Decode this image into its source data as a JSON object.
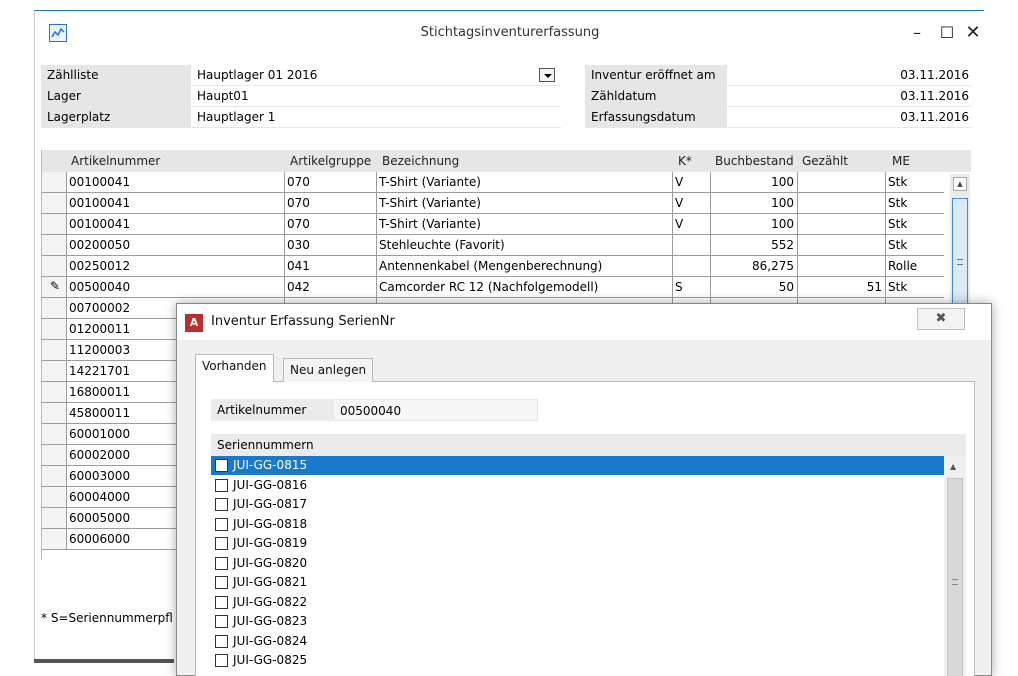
{
  "window": {
    "title": "Stichtagsinventurerfassung",
    "minimize": "–",
    "maximize": "☐",
    "close": "✕"
  },
  "header": {
    "left": [
      {
        "label": "Zählliste",
        "value": "Hauptlager 01 2016"
      },
      {
        "label": "Lager",
        "value": "Haupt01"
      },
      {
        "label": "Lagerplatz",
        "value": "Hauptlager 1"
      }
    ],
    "right": [
      {
        "label": "Inventur eröffnet am",
        "value": "03.11.2016"
      },
      {
        "label": "Zähldatum",
        "value": "03.11.2016"
      },
      {
        "label": "Erfassungsdatum",
        "value": "03.11.2016"
      }
    ]
  },
  "grid": {
    "columns": [
      "Artikelnummer",
      "Artikelgruppe",
      "Bezeichnung",
      "K*",
      "Buchbestand",
      "Gezählt",
      "ME"
    ],
    "rows": [
      [
        "00100041",
        "070",
        "T-Shirt (Variante)",
        "V",
        "100",
        "",
        "Stk"
      ],
      [
        "00100041",
        "070",
        "T-Shirt (Variante)",
        "V",
        "100",
        "",
        "Stk"
      ],
      [
        "00100041",
        "070",
        "T-Shirt (Variante)",
        "V",
        "100",
        "",
        "Stk"
      ],
      [
        "00200050",
        "030",
        "Stehleuchte  (Favorit)",
        "",
        "552",
        "",
        "Stk"
      ],
      [
        "00250012",
        "041",
        "Antennenkabel (Mengenberechnung)",
        "",
        "86,275",
        "",
        "Rolle"
      ],
      [
        "00500040",
        "042",
        "Camcorder RC 12 (Nachfolgemodell)",
        "S",
        "50",
        "51",
        "Stk"
      ],
      [
        "00700002",
        "",
        "",
        "",
        "",
        "",
        ""
      ],
      [
        "01200011",
        "",
        "",
        "",
        "",
        "",
        ""
      ],
      [
        "11200003",
        "",
        "",
        "",
        "",
        "",
        ""
      ],
      [
        "14221701",
        "",
        "",
        "",
        "",
        "",
        ""
      ],
      [
        "16800011",
        "",
        "",
        "",
        "",
        "",
        ""
      ],
      [
        "45800011",
        "",
        "",
        "",
        "",
        "",
        ""
      ],
      [
        "60001000",
        "",
        "",
        "",
        "",
        "",
        ""
      ],
      [
        "60002000",
        "",
        "",
        "",
        "",
        "",
        ""
      ],
      [
        "60003000",
        "",
        "",
        "",
        "",
        "",
        ""
      ],
      [
        "60004000",
        "",
        "",
        "",
        "",
        "",
        ""
      ],
      [
        "60005000",
        "",
        "",
        "",
        "",
        "",
        ""
      ],
      [
        "60006000",
        "",
        "",
        "",
        "",
        "",
        ""
      ]
    ],
    "editing_row_marker": "✎"
  },
  "footnote": "* S=Seriennummerpfl",
  "dialog": {
    "title": "Inventur Erfassung SerienNr",
    "close": "✖",
    "app_icon": "A",
    "tabs": [
      "Vorhanden",
      "Neu anlegen"
    ],
    "artikel_label": "Artikelnummer",
    "artikel_value": "00500040",
    "list_header": "Seriennummern",
    "serials": [
      "JUI-GG-0815",
      "JUI-GG-0816",
      "JUI-GG-0817",
      "JUI-GG-0818",
      "JUI-GG-0819",
      "JUI-GG-0820",
      "JUI-GG-0821",
      "JUI-GG-0822",
      "JUI-GG-0823",
      "JUI-GG-0824",
      "JUI-GG-0825"
    ]
  }
}
